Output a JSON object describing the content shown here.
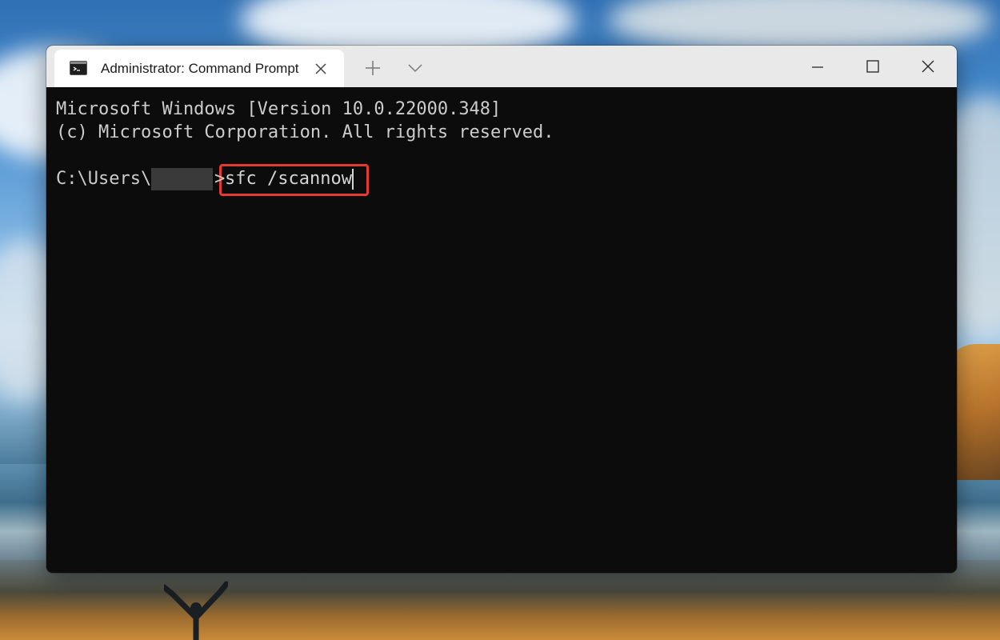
{
  "window": {
    "tab_title": "Administrator: Command Prompt"
  },
  "console": {
    "line1": "Microsoft Windows [Version 10.0.22000.348]",
    "line2": "(c) Microsoft Corporation. All rights reserved.",
    "prompt_prefix": "C:\\Users\\",
    "prompt_suffix": ">",
    "command": "sfc /scannow"
  },
  "icons": {
    "tab_icon": "command-prompt-icon",
    "tab_close": "close-icon",
    "new_tab": "plus-icon",
    "dropdown": "chevron-down-icon",
    "minimize": "minimize-icon",
    "maximize": "maximize-icon",
    "close": "close-icon"
  },
  "colors": {
    "console_bg": "#0c0c0c",
    "console_text": "#cccccc",
    "highlight": "#e53935",
    "titlebar": "#e9e9e9"
  }
}
